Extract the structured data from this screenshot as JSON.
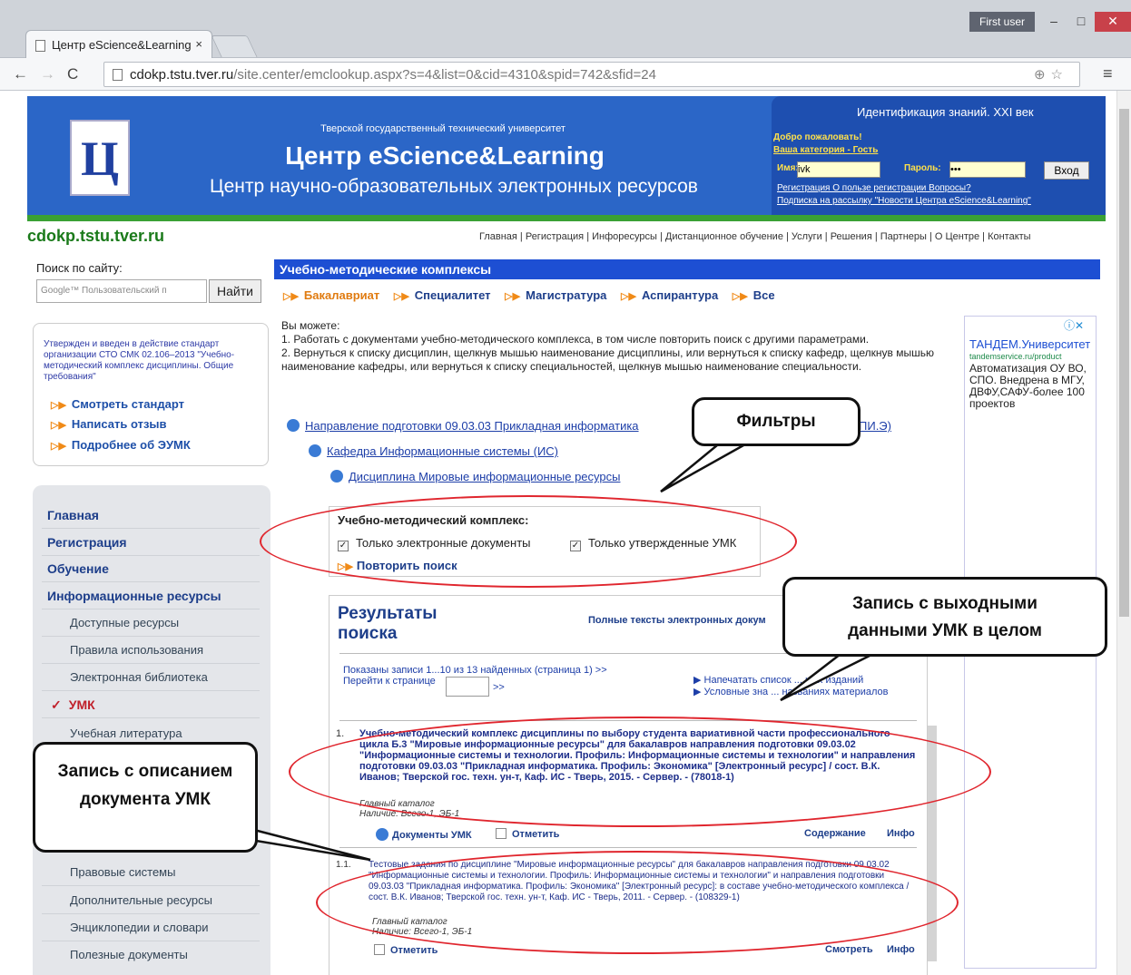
{
  "browser": {
    "tab_title": "Центр eScience&Learning",
    "tab_close": "×",
    "user": "First user",
    "url_host": "cdokp.tstu.tver.ru",
    "url_path": "/site.center/emclookup.aspx?s=4&list=0&cid=4310&spid=742&sfid=24"
  },
  "banner": {
    "logo": "Ц",
    "university": "Тверской государственный технический университет",
    "title": "Центр eScience&Learning",
    "subtitle": "Центр научно-образовательных электронных ресурсов",
    "tagline": "Идентификация знаний. XXI век",
    "welcome": "Добро пожаловать!",
    "category": "Ваша категория - Гость",
    "name_label": "Имя:",
    "name_value": "ivk",
    "password_label": "Пароль:",
    "password_value": "•••",
    "login_button": "Вход",
    "links_line1": "Регистрация   О пользе регистрации   Вопросы?",
    "links_line2": "Подписка на рассылку \"Новости Центра eScience&Learning\""
  },
  "site": {
    "name": "cdokp.tstu.tver.ru",
    "topnav": "Главная | Регистрация | Инфоресурсы | Дистанционное обучение | Услуги | Решения | Партнеры | О Центре | Контакты"
  },
  "sidebar": {
    "search_label": "Поиск по сайту:",
    "search_placeholder": "Google™ Пользовательский п",
    "search_button": "Найти",
    "standard_text": "Утвержден и введен в действие стандарт организации СТО СМК 02.106–2013 \"Учебно-методический комплекс дисциплины. Общие требования\"",
    "standard_links": [
      "Смотреть стандарт",
      "Написать отзыв",
      "Подробнее об ЭУМК"
    ],
    "nav_main": [
      "Главная",
      "Регистрация",
      "Обучение",
      "Информационные ресурсы"
    ],
    "nav_sub": [
      "Доступные ресурсы",
      "Правила использования",
      "Электронная библиотека"
    ],
    "nav_active": "УМК",
    "nav_sub2": [
      "Учебная литература",
      "Правовые системы",
      "Дополнительные ресурсы",
      "Энциклопедии и словари",
      "Полезные документы"
    ]
  },
  "main": {
    "heading": "Учебно-методические комплексы",
    "levels": [
      "Бакалавриат",
      "Специалитет",
      "Магистратура",
      "Аспирантура",
      "Все"
    ],
    "intro_lead": "Вы можете:",
    "intro_1": "1. Работать с документами учебно-методического комплекса, в том числе повторить поиск с другими параметрами.",
    "intro_2": "2. Вернуться к списку дисциплин, щелкнув мышью наименование дисциплины, или вернуться к списку кафедр, щелкнув мышью наименование кафедры, или вернуться к списку специальностей, щелкнув мышью наименование специальности.",
    "crumb_direction": "Направление подготовки 09.03.03 Прикладная информатика",
    "crumb_direction_tail": "ПИ.Э)",
    "crumb_department": "Кафедра Информационные системы (ИС)",
    "crumb_discipline": "Дисциплина Мировые информационные ресурсы",
    "filter_title": "Учебно-методический комплекс:",
    "filter_1": "Только электронные документы",
    "filter_2": "Только утвержденные УМК",
    "repeat_search": "Повторить поиск",
    "results_title": "Результаты поиска",
    "full_texts": "Полные тексты электронных докум",
    "shown": "Показаны записи 1...10 из 13 найденных (страница 1) >>",
    "goto_page": "Перейти к странице",
    "goto_arrow": ">>",
    "print_list": "Напечатать список ... ных изданий",
    "legend": "Условные зна ... названиях материалов",
    "record1_num": "1.",
    "record1": "Учебно-методический комплекс дисциплины по выбору студента вариативной части профессионального цикла Б.3 \"Мировые информационные ресурсы\" для бакалавров направления подготовки 09.03.02 \"Информационные системы и технологии. Профиль: Информационные системы и технологии\" и направления подготовки 09.03.03 \"Прикладная информатика. Профиль: Экономика\" [Электронный ресурс] / сост. В.К. Иванов; Тверской гос. техн. ун-т, Каф. ИС - Тверь, 2015. - Сервер. - (78018-1)",
    "catalog": "Главный каталог",
    "availability": "Наличие: Всего-1, ЭБ-1",
    "umk_docs": "Документы УМК",
    "mark": "Отметить",
    "contents": "Содержание",
    "info": "Инфо",
    "record2_num": "1.1.",
    "record2": "Тестовые задания по дисциплине \"Мировые информационные ресурсы\" для бакалавров направления подготовки 09.03.02 \"Информационные системы и технологии. Профиль: Информационные системы и технологии\" и направления подготовки 09.03.03 \"Прикладная информатика. Профиль: Экономика\" [Электронный ресурс]: в составе учебно-методического комплекса / сост. В.К. Иванов; Тверской гос. техн. ун-т, Каф. ИС - Тверь, 2011. - Сервер. - (108329-1)",
    "view": "Смотреть"
  },
  "ad": {
    "headline": "ТАНДЕМ.Университет",
    "url": "tandemservice.ru/product",
    "text": "Автоматизация ОУ ВО, СПО. Внедрена в МГУ, ДВФУ,САФУ-более 100 проектов"
  },
  "annotations": {
    "filters": "Фильтры",
    "umk_record": "Запись с выходными данными УМК в целом",
    "doc_record": "Запись с описанием документа УМК"
  }
}
